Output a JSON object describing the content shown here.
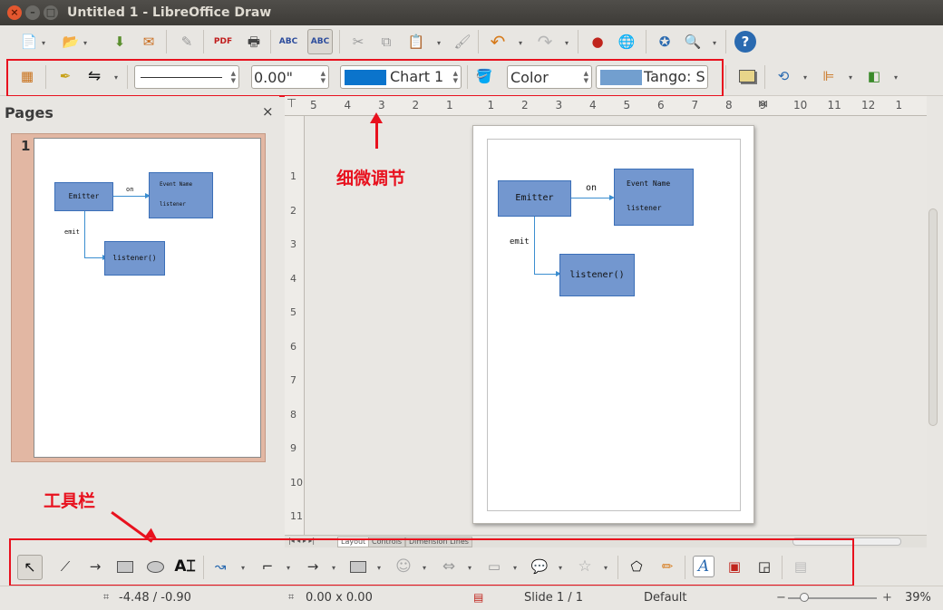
{
  "window": {
    "title": "Untitled 1 - LibreOffice Draw"
  },
  "line_props": {
    "width_value": "0.00\"",
    "line_color_name": "Chart 1",
    "area_style": "Color",
    "area_color_name": "Tango: S"
  },
  "colors": {
    "line_color": "#0b74cc",
    "area_color": "#729fcf",
    "annotation": "#e8111e",
    "thumb_bg": "#e2b7a3"
  },
  "pages_panel": {
    "title": "Pages",
    "close": "×",
    "page_number": "1"
  },
  "diagram": {
    "emitter": "Emitter",
    "event_name": "Event Name",
    "listener": "listener",
    "on": "on",
    "emit": "emit",
    "listener_fn": "listener()"
  },
  "ruler": {
    "h_ticks": [
      "5",
      "4",
      "3",
      "2",
      "1",
      "1",
      "2",
      "3",
      "4",
      "5",
      "6",
      "7",
      "8",
      "9",
      "10",
      "11",
      "12",
      "1"
    ],
    "v_ticks": [
      "1",
      "2",
      "3",
      "4",
      "5",
      "6",
      "7",
      "8",
      "9",
      "10",
      "11"
    ]
  },
  "annotations": {
    "fine_tuning": "细微调节",
    "toolbar": "工具栏"
  },
  "tabs": [
    "Layout",
    "Controls",
    "Dimension Lines"
  ],
  "status": {
    "position": "-4.48 / -0.90",
    "size": "0.00 x 0.00",
    "slide": "Slide 1 / 1",
    "layout": "Default",
    "zoom": "39%"
  }
}
